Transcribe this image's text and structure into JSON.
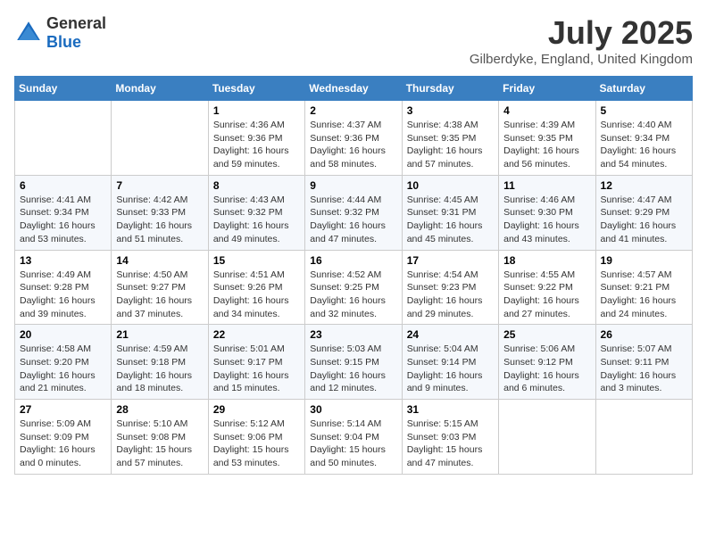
{
  "header": {
    "logo_general": "General",
    "logo_blue": "Blue",
    "month_title": "July 2025",
    "location": "Gilberdyke, England, United Kingdom"
  },
  "calendar": {
    "days_of_week": [
      "Sunday",
      "Monday",
      "Tuesday",
      "Wednesday",
      "Thursday",
      "Friday",
      "Saturday"
    ],
    "weeks": [
      [
        {
          "day": "",
          "info": ""
        },
        {
          "day": "",
          "info": ""
        },
        {
          "day": "1",
          "info": "Sunrise: 4:36 AM\nSunset: 9:36 PM\nDaylight: 16 hours and 59 minutes."
        },
        {
          "day": "2",
          "info": "Sunrise: 4:37 AM\nSunset: 9:36 PM\nDaylight: 16 hours and 58 minutes."
        },
        {
          "day": "3",
          "info": "Sunrise: 4:38 AM\nSunset: 9:35 PM\nDaylight: 16 hours and 57 minutes."
        },
        {
          "day": "4",
          "info": "Sunrise: 4:39 AM\nSunset: 9:35 PM\nDaylight: 16 hours and 56 minutes."
        },
        {
          "day": "5",
          "info": "Sunrise: 4:40 AM\nSunset: 9:34 PM\nDaylight: 16 hours and 54 minutes."
        }
      ],
      [
        {
          "day": "6",
          "info": "Sunrise: 4:41 AM\nSunset: 9:34 PM\nDaylight: 16 hours and 53 minutes."
        },
        {
          "day": "7",
          "info": "Sunrise: 4:42 AM\nSunset: 9:33 PM\nDaylight: 16 hours and 51 minutes."
        },
        {
          "day": "8",
          "info": "Sunrise: 4:43 AM\nSunset: 9:32 PM\nDaylight: 16 hours and 49 minutes."
        },
        {
          "day": "9",
          "info": "Sunrise: 4:44 AM\nSunset: 9:32 PM\nDaylight: 16 hours and 47 minutes."
        },
        {
          "day": "10",
          "info": "Sunrise: 4:45 AM\nSunset: 9:31 PM\nDaylight: 16 hours and 45 minutes."
        },
        {
          "day": "11",
          "info": "Sunrise: 4:46 AM\nSunset: 9:30 PM\nDaylight: 16 hours and 43 minutes."
        },
        {
          "day": "12",
          "info": "Sunrise: 4:47 AM\nSunset: 9:29 PM\nDaylight: 16 hours and 41 minutes."
        }
      ],
      [
        {
          "day": "13",
          "info": "Sunrise: 4:49 AM\nSunset: 9:28 PM\nDaylight: 16 hours and 39 minutes."
        },
        {
          "day": "14",
          "info": "Sunrise: 4:50 AM\nSunset: 9:27 PM\nDaylight: 16 hours and 37 minutes."
        },
        {
          "day": "15",
          "info": "Sunrise: 4:51 AM\nSunset: 9:26 PM\nDaylight: 16 hours and 34 minutes."
        },
        {
          "day": "16",
          "info": "Sunrise: 4:52 AM\nSunset: 9:25 PM\nDaylight: 16 hours and 32 minutes."
        },
        {
          "day": "17",
          "info": "Sunrise: 4:54 AM\nSunset: 9:23 PM\nDaylight: 16 hours and 29 minutes."
        },
        {
          "day": "18",
          "info": "Sunrise: 4:55 AM\nSunset: 9:22 PM\nDaylight: 16 hours and 27 minutes."
        },
        {
          "day": "19",
          "info": "Sunrise: 4:57 AM\nSunset: 9:21 PM\nDaylight: 16 hours and 24 minutes."
        }
      ],
      [
        {
          "day": "20",
          "info": "Sunrise: 4:58 AM\nSunset: 9:20 PM\nDaylight: 16 hours and 21 minutes."
        },
        {
          "day": "21",
          "info": "Sunrise: 4:59 AM\nSunset: 9:18 PM\nDaylight: 16 hours and 18 minutes."
        },
        {
          "day": "22",
          "info": "Sunrise: 5:01 AM\nSunset: 9:17 PM\nDaylight: 16 hours and 15 minutes."
        },
        {
          "day": "23",
          "info": "Sunrise: 5:03 AM\nSunset: 9:15 PM\nDaylight: 16 hours and 12 minutes."
        },
        {
          "day": "24",
          "info": "Sunrise: 5:04 AM\nSunset: 9:14 PM\nDaylight: 16 hours and 9 minutes."
        },
        {
          "day": "25",
          "info": "Sunrise: 5:06 AM\nSunset: 9:12 PM\nDaylight: 16 hours and 6 minutes."
        },
        {
          "day": "26",
          "info": "Sunrise: 5:07 AM\nSunset: 9:11 PM\nDaylight: 16 hours and 3 minutes."
        }
      ],
      [
        {
          "day": "27",
          "info": "Sunrise: 5:09 AM\nSunset: 9:09 PM\nDaylight: 16 hours and 0 minutes."
        },
        {
          "day": "28",
          "info": "Sunrise: 5:10 AM\nSunset: 9:08 PM\nDaylight: 15 hours and 57 minutes."
        },
        {
          "day": "29",
          "info": "Sunrise: 5:12 AM\nSunset: 9:06 PM\nDaylight: 15 hours and 53 minutes."
        },
        {
          "day": "30",
          "info": "Sunrise: 5:14 AM\nSunset: 9:04 PM\nDaylight: 15 hours and 50 minutes."
        },
        {
          "day": "31",
          "info": "Sunrise: 5:15 AM\nSunset: 9:03 PM\nDaylight: 15 hours and 47 minutes."
        },
        {
          "day": "",
          "info": ""
        },
        {
          "day": "",
          "info": ""
        }
      ]
    ]
  }
}
